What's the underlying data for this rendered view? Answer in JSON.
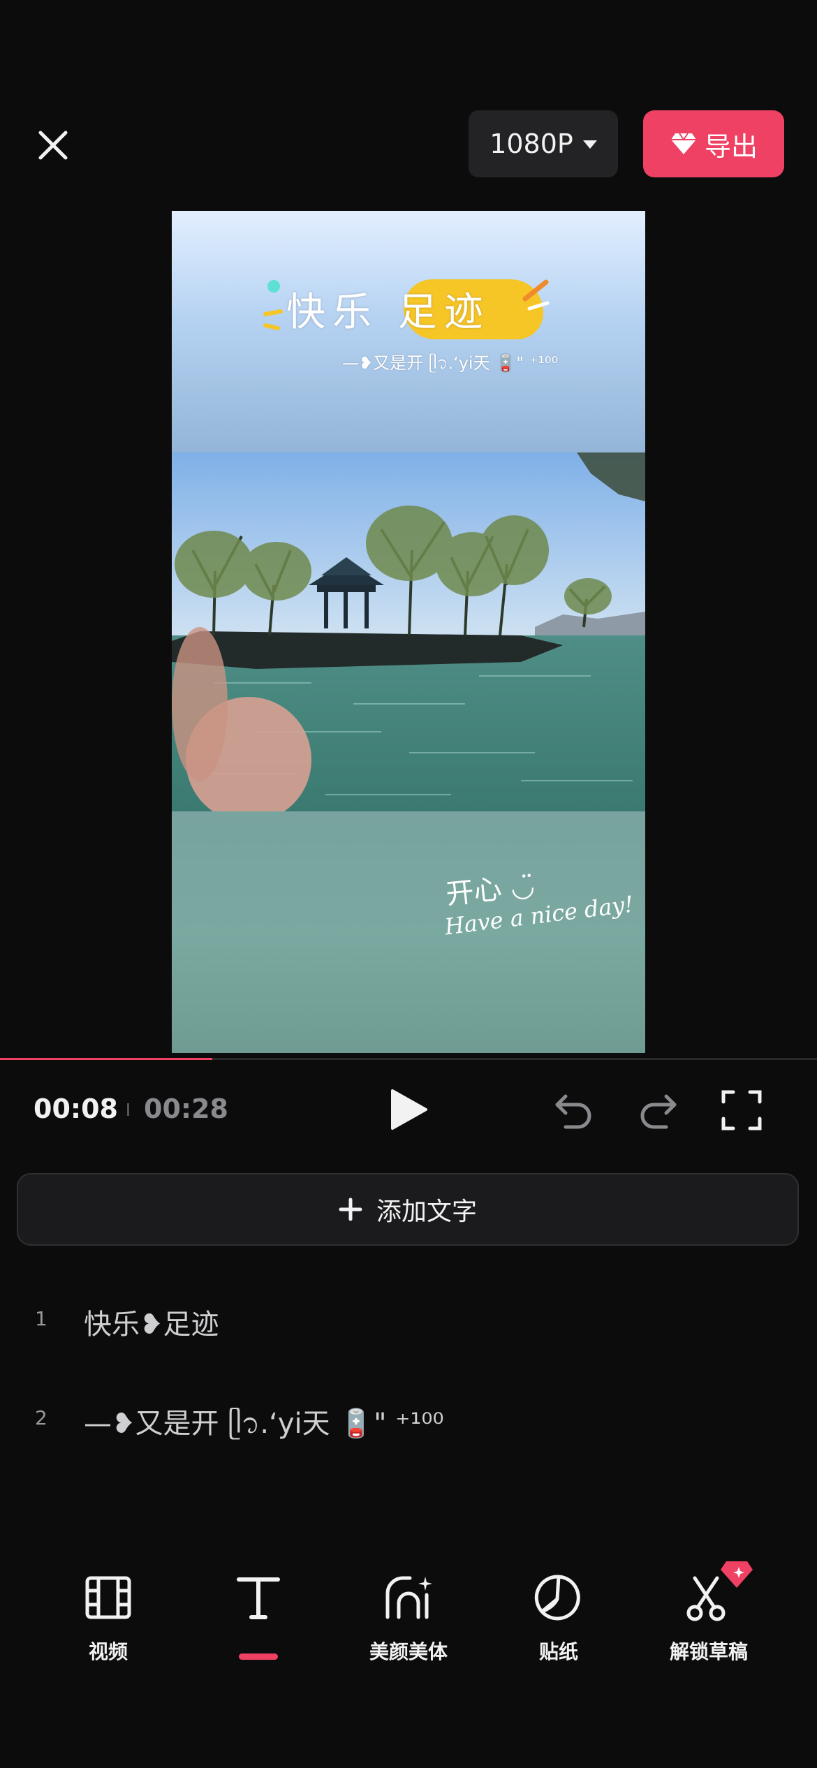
{
  "header": {
    "resolution": "1080P",
    "export_label": "导出"
  },
  "preview": {
    "title_sticker": "快乐 足迹",
    "sub_line": "—❥又是开 ᥫ᭡.‘yi天 🪫\" ⁺¹⁰⁰",
    "caption_line1": "开心 ◡̈",
    "caption_line2": "Have a nice day!"
  },
  "playback": {
    "current_time": "00:08",
    "total_time": "00:28",
    "progress_fraction": 0.26
  },
  "add_text_button": "添加文字",
  "text_list": [
    {
      "index": "1",
      "text": "快乐❥足迹"
    },
    {
      "index": "2",
      "text": "—❥又是开 ᥫ᭡.‘yi天 🪫\" ⁺¹⁰⁰"
    }
  ],
  "toolbar": {
    "items": [
      {
        "label": "视频",
        "icon": "film-icon"
      },
      {
        "label": "",
        "icon": "text-icon"
      },
      {
        "label": "美颜美体",
        "icon": "beauty-icon"
      },
      {
        "label": "贴纸",
        "icon": "sticker-icon"
      },
      {
        "label": "解锁草稿",
        "icon": "scissors-icon"
      }
    ],
    "active_index": 1
  },
  "colors": {
    "accent": "#ee4163",
    "background": "#0c0c0d",
    "button_bg": "#232325"
  }
}
